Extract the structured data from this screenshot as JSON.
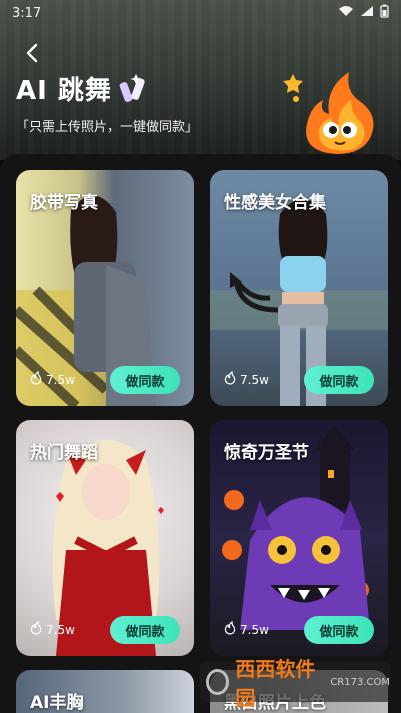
{
  "status": {
    "time": "3:17"
  },
  "header": {
    "title": "AI 跳舞",
    "subtitle": "「只需上传照片，一键做同款」"
  },
  "cards": [
    {
      "label": "胶带写真",
      "likes": "7.5w",
      "action": "做同款"
    },
    {
      "label": "性感美女合集",
      "likes": "7.5w",
      "action": "做同款"
    },
    {
      "label": "热门舞蹈",
      "likes": "7.5w",
      "action": "做同款"
    },
    {
      "label": "惊奇万圣节",
      "likes": "7.5w",
      "action": "做同款"
    },
    {
      "label": "AI丰胸"
    },
    {
      "label": "黑白照片上色"
    }
  ],
  "watermark": {
    "brand": "西西软件园",
    "url": "CR173.COM"
  },
  "colors": {
    "accent": "#3de3b9",
    "sheet": "#141414"
  }
}
